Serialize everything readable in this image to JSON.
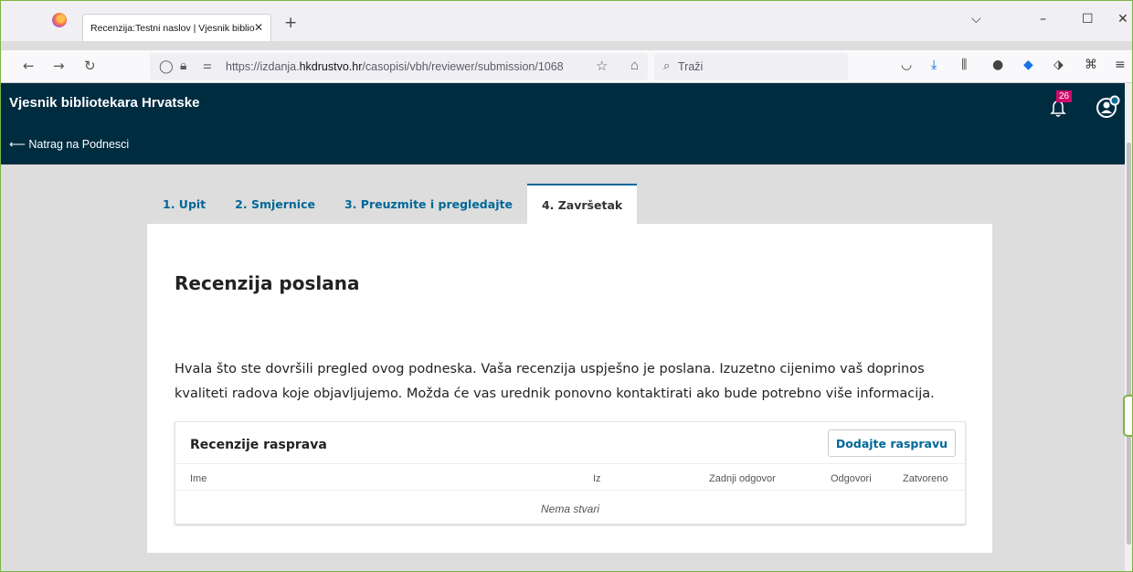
{
  "browser": {
    "tab_title": "Recenzija:Testni naslov | Vjesnik bibliot",
    "url_prefix": "https://izdanja.",
    "url_domain": "hkdrustvo.hr",
    "url_path": "/casopisi/vbh/reviewer/submission/1068",
    "search_placeholder": "Traži"
  },
  "header": {
    "site_title": "Vjesnik bibliotekara Hrvatske",
    "back_link": "⟵ Natrag na Podnesci",
    "notification_count": "26"
  },
  "wizard": {
    "tabs": [
      {
        "label": "1. Upit"
      },
      {
        "label": "2. Smjernice"
      },
      {
        "label": "3. Preuzmite i pregledajte"
      },
      {
        "label": "4. Završetak"
      }
    ],
    "active_index": 3
  },
  "main": {
    "heading": "Recenzija poslana",
    "message": "Hvala što ste dovršili pregled ovog podneska. Vaša recenzija uspješno je poslana. Izuzetno cijenimo vaš doprinos kvaliteti radova koje objavljujemo. Možda će vas urednik ponovno kontaktirati ako bude potrebno više informacija."
  },
  "discussions": {
    "title": "Recenzije rasprava",
    "add_button": "Dodajte raspravu",
    "columns": [
      "Ime",
      "Iz",
      "Zadnji odgovor",
      "Odgovori",
      "Zatvoreno"
    ],
    "empty_text": "Nema stvari"
  },
  "colors": {
    "header_bg": "#002c40",
    "link": "#006798",
    "badge": "#d00a6c"
  }
}
